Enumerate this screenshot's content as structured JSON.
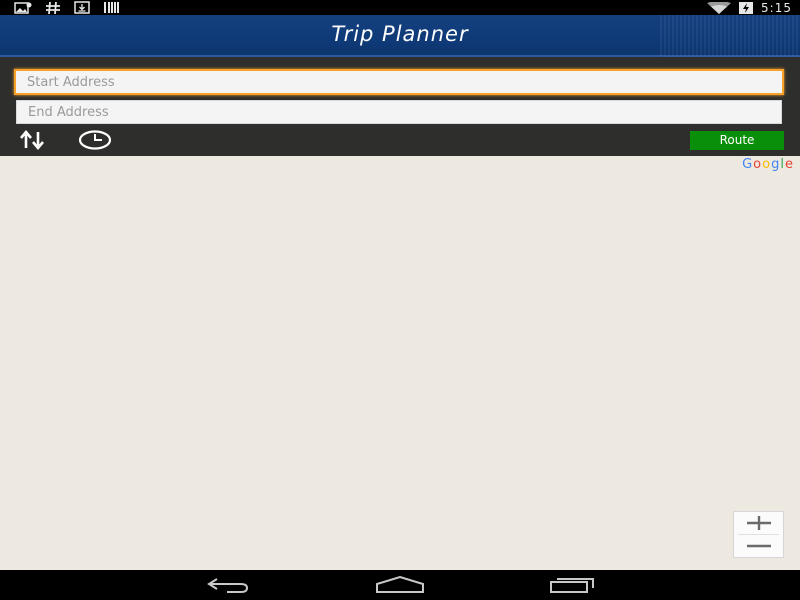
{
  "status_bar": {
    "time": "5:15",
    "icons": [
      "image-icon",
      "hash-icon",
      "download-icon",
      "barcode-icon",
      "wifi-icon",
      "battery-charging-icon"
    ]
  },
  "header": {
    "title": "Trip Planner"
  },
  "search": {
    "start_placeholder": "Start Address",
    "end_placeholder": "End Address",
    "route_label": "Route",
    "accent_color": "#f7a12a",
    "route_color": "#0a8f0a"
  },
  "map": {
    "provider_logo": "Google",
    "background_color": "#ede9e1",
    "zoom_in_icon": "plus-icon",
    "zoom_out_icon": "minus-icon"
  },
  "nav_bar": {
    "icons": [
      "back-icon",
      "home-icon",
      "recents-icon"
    ]
  }
}
